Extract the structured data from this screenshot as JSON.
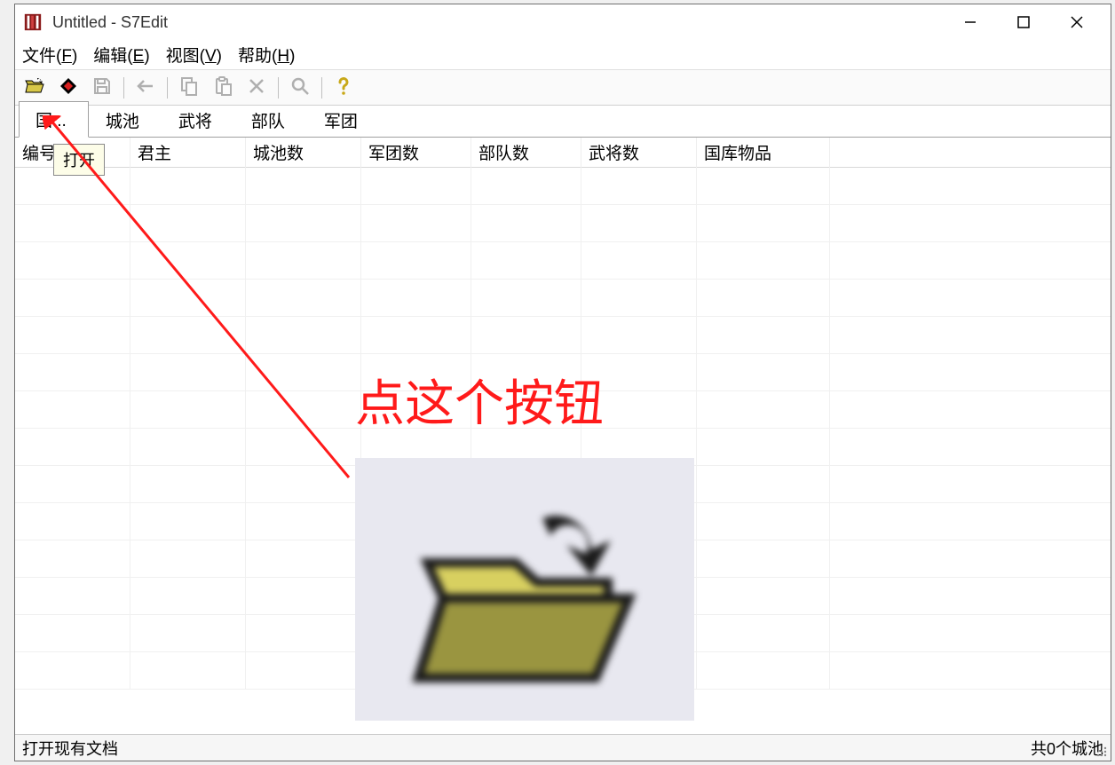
{
  "window": {
    "title": "Untitled - S7Edit"
  },
  "menu": {
    "file": {
      "label": "文件",
      "accel": "F"
    },
    "edit": {
      "label": "编辑",
      "accel": "E"
    },
    "view": {
      "label": "视图",
      "accel": "V"
    },
    "help": {
      "label": "帮助",
      "accel": "H"
    }
  },
  "toolbar": {
    "open_icon": "folder-open",
    "item2_icon": "diamond",
    "save_icon": "save",
    "back_icon": "arrow-left",
    "copy_icon": "copy",
    "paste_icon": "paste",
    "delete_icon": "delete-x",
    "find_icon": "magnifier",
    "help_icon": "question"
  },
  "tooltip": {
    "open_label": "打开"
  },
  "tabs": {
    "t0": "国...",
    "t1": "城池",
    "t2": "武将",
    "t3": "部队",
    "t4": "军团"
  },
  "columns": {
    "c0": "编号",
    "c1": "君主",
    "c2": "城池数",
    "c3": "军团数",
    "c4": "部队数",
    "c5": "武将数",
    "c6": "国库物品"
  },
  "annotation": {
    "text": "点这个按钮"
  },
  "statusbar": {
    "left": "打开现有文档",
    "right": "共0个城池"
  }
}
